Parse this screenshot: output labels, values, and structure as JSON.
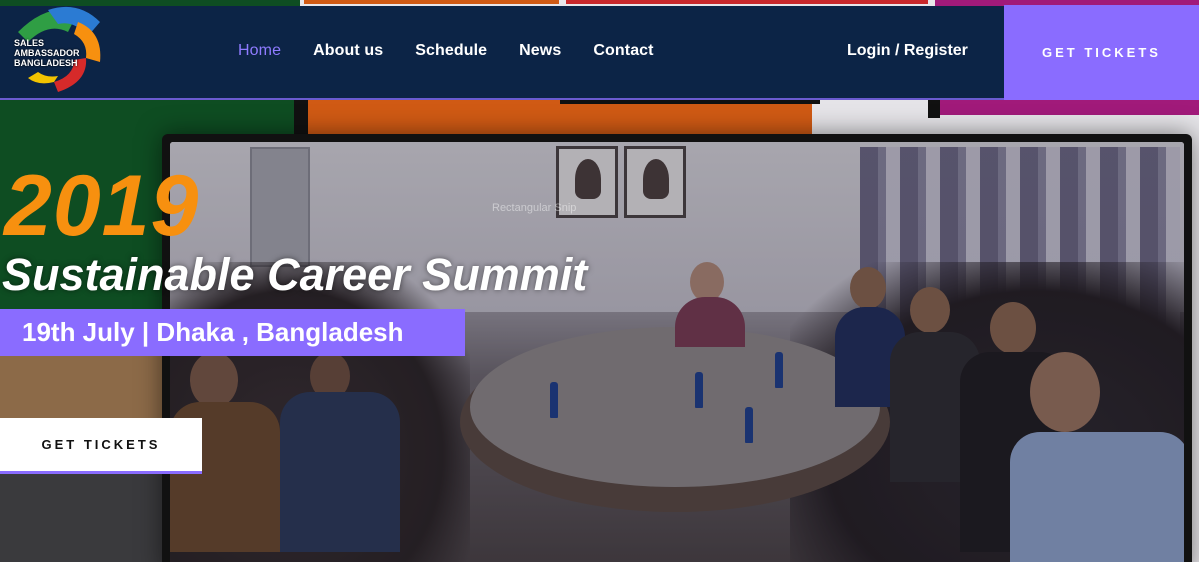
{
  "brand": {
    "logo_lines": [
      "SALES",
      "AMBASSADOR",
      "BANGLADESH"
    ],
    "accent_color": "#8a6cff",
    "header_color": "#0c2446",
    "year_color": "#f7900f"
  },
  "nav": {
    "items": [
      {
        "label": "Home",
        "active": true
      },
      {
        "label": "About us",
        "active": false
      },
      {
        "label": "Schedule",
        "active": false
      },
      {
        "label": "News",
        "active": false
      },
      {
        "label": "Contact",
        "active": false
      }
    ],
    "login_label": "Login / Register",
    "tickets_label": "GET TICKETS"
  },
  "hero": {
    "year": "2019",
    "title": "Sustainable Career Summit",
    "date_location": "19th July  | Dhaka , Bangladesh",
    "cta_label": "GET TICKETS",
    "photo_caption": "Rectangular Snip"
  }
}
